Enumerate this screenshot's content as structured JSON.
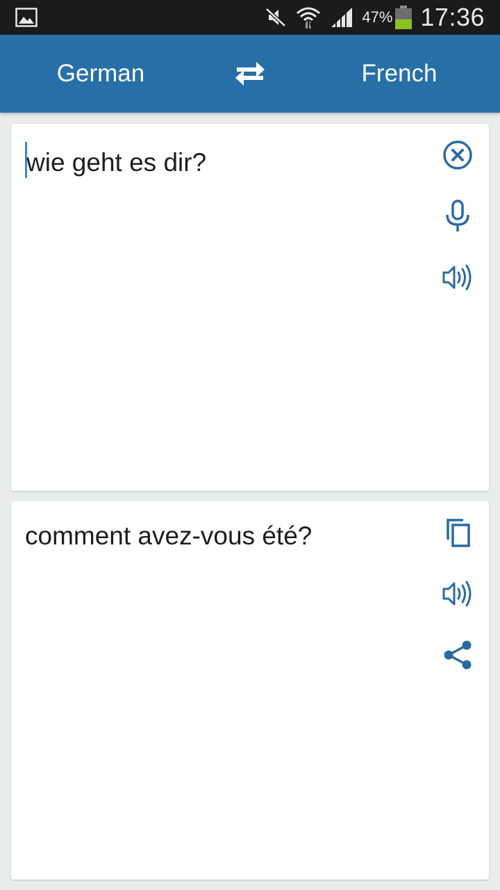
{
  "status_bar": {
    "battery_percent": "47%",
    "battery_level": 0.47,
    "time": "17:36",
    "icons": [
      "image-notification-icon",
      "mute-icon",
      "wifi-icon",
      "signal-icon",
      "battery-icon"
    ]
  },
  "header": {
    "source_language": "German",
    "target_language": "French",
    "swap_icon": "swap-arrows-icon"
  },
  "input_card": {
    "text": "wie geht es dir?",
    "actions": [
      "clear-icon",
      "microphone-icon",
      "speaker-icon"
    ]
  },
  "output_card": {
    "text": "comment avez-vous été?",
    "actions": [
      "copy-icon",
      "speaker-icon",
      "share-icon"
    ]
  },
  "colors": {
    "app_bar": "#2770a7",
    "icon_accent": "#2a6aa3",
    "caret": "#2a8fe0",
    "battery_fill": "#8cc11f"
  }
}
